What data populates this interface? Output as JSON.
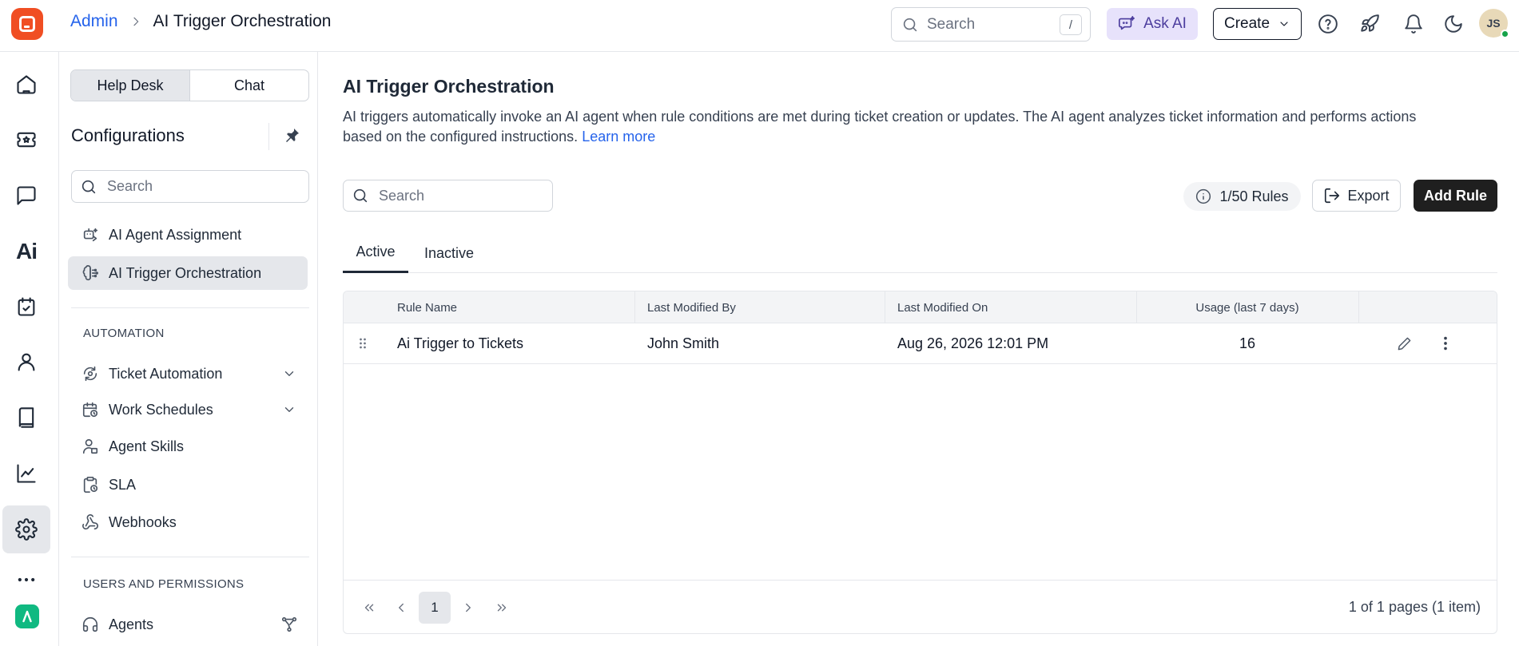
{
  "header": {
    "breadcrumb_root": "Admin",
    "breadcrumb_current": "AI Trigger Orchestration",
    "search_placeholder": "Search",
    "search_shortcut": "/",
    "ask_ai_label": "Ask AI",
    "create_label": "Create",
    "avatar_initials": "JS"
  },
  "config_sidebar": {
    "segments": [
      "Help Desk",
      "Chat"
    ],
    "title": "Configurations",
    "search_placeholder": "Search",
    "items": [
      {
        "label": "AI Agent Assignment"
      },
      {
        "label": "AI Trigger Orchestration"
      }
    ],
    "section_automation": "AUTOMATION",
    "automation_items": [
      {
        "label": "Ticket Automation"
      },
      {
        "label": "Work Schedules"
      },
      {
        "label": "Agent Skills"
      },
      {
        "label": "SLA"
      },
      {
        "label": "Webhooks"
      }
    ],
    "section_users": "USERS AND PERMISSIONS",
    "users_items": [
      {
        "label": "Agents"
      }
    ]
  },
  "main": {
    "title": "AI Trigger Orchestration",
    "description": "AI triggers automatically invoke an AI agent when rule conditions are met during ticket creation or updates. The AI agent analyzes ticket information and performs actions based on the configured instructions.",
    "learn_more": "Learn more",
    "search_placeholder": "Search",
    "rules_badge": "1/50 Rules",
    "export_label": "Export",
    "add_rule_label": "Add Rule",
    "tabs": [
      "Active",
      "Inactive"
    ],
    "table": {
      "columns": [
        "Rule Name",
        "Last Modified By",
        "Last Modified On",
        "Usage (last 7 days)"
      ],
      "rows": [
        {
          "rule_name": "Ai Trigger to Tickets",
          "modified_by": "John Smith",
          "modified_on": "Aug 26, 2026 12:01 PM",
          "usage": "16"
        }
      ]
    },
    "pagination": {
      "current_page": "1",
      "info": "1 of 1 pages (1 item)"
    }
  },
  "colors": {
    "brand": "#f04e23",
    "link": "#2563eb",
    "ask_ai_bg": "#e7e2fb",
    "primary_button": "#1f1f1f"
  }
}
